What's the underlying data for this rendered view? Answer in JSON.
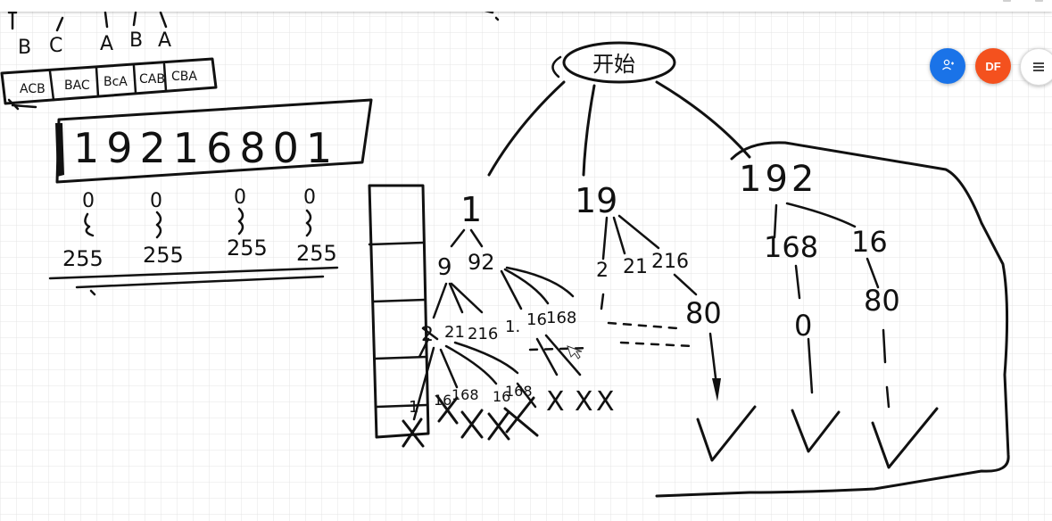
{
  "toolbar": {
    "user_button_icon": "add-user-icon",
    "avatar_initials": "DF",
    "menu_icon": "hamburger-menu-icon",
    "colors": {
      "user_button": "#1a73e8",
      "avatar": "#f4511e"
    }
  },
  "whiteboard": {
    "grid_color": "#e4e4e4",
    "ink_color": "#111111",
    "top_letters": [
      "B",
      "C",
      "A",
      "B",
      "A"
    ],
    "permutations": [
      "ACB",
      "BAC",
      "BcA",
      "CAB",
      "CBA"
    ],
    "ip_string": "19216801",
    "ranges": [
      {
        "from": "0",
        "to": "255"
      },
      {
        "from": "0",
        "to": "255"
      },
      {
        "from": "0",
        "to": "255"
      },
      {
        "from": "0",
        "to": "255"
      }
    ],
    "root_label": "开始",
    "tree": {
      "level1": [
        "1",
        "19",
        "192"
      ],
      "under_1": [
        "9",
        "92"
      ],
      "under_19": [
        "2",
        "21",
        "216"
      ],
      "under_192": [
        "168",
        "16"
      ],
      "under_9": [
        "2",
        "21",
        "216"
      ],
      "under_92": [
        "1.",
        "16",
        "168"
      ],
      "under_216": "80",
      "under_168": "0",
      "under_16": "80",
      "bottom_left": [
        "1",
        "16",
        "168",
        "16",
        "168"
      ],
      "crosses": [
        "X",
        "X",
        "X"
      ]
    }
  }
}
